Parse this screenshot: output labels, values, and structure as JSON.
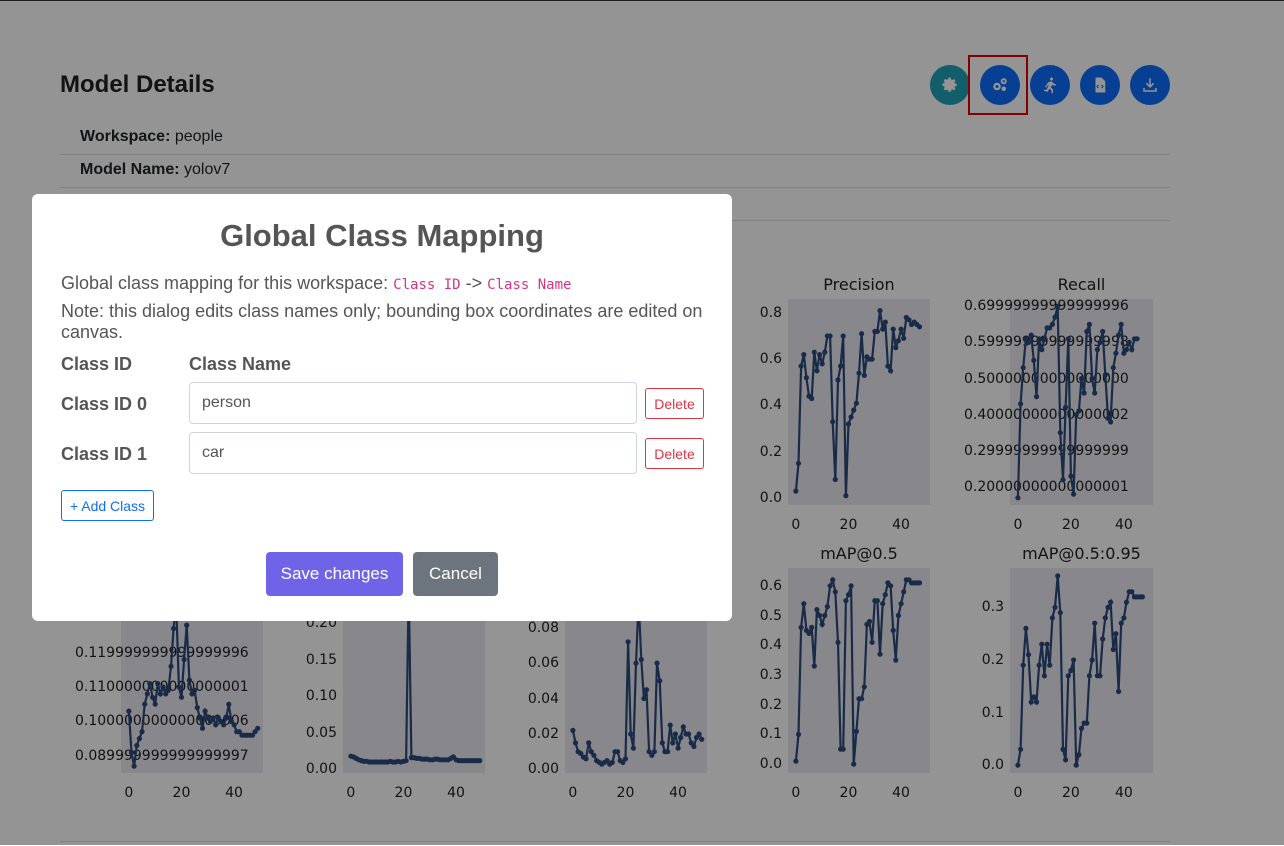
{
  "page": {
    "title": "Model Details",
    "details": [
      {
        "label": "Workspace:",
        "value": "people"
      },
      {
        "label": "Model Name:",
        "value": "yolov7"
      },
      {
        "label": "",
        "value": ""
      }
    ],
    "toolbar": [
      {
        "icon": "gear-icon",
        "color": "#20a4b8"
      },
      {
        "icon": "gears-icon",
        "color": "#0d6efd",
        "highlighted": true
      },
      {
        "icon": "run-icon",
        "color": "#0d6efd"
      },
      {
        "icon": "code-file-icon",
        "color": "#0d6efd"
      },
      {
        "icon": "download-icon",
        "color": "#0d6efd"
      }
    ]
  },
  "modal": {
    "title": "Global Class Mapping",
    "intro_text": "Global class mapping for this workspace:",
    "intro_code_from": "Class ID",
    "intro_arrow": "->",
    "intro_code_to": "Class Name",
    "note": "Note: this dialog edits class names only; bounding box coordinates are edited on canvas.",
    "col_id_header": "Class ID",
    "col_name_header": "Class Name",
    "rows": [
      {
        "id_label": "Class ID 0",
        "name": "person",
        "delete_label": "Delete"
      },
      {
        "id_label": "Class ID 1",
        "name": "car",
        "delete_label": "Delete"
      }
    ],
    "add_label": "+ Add Class",
    "save_label": "Save changes",
    "cancel_label": "Cancel"
  },
  "chart_data": [
    {
      "type": "line",
      "title": "Precision",
      "x_ticks": [
        0,
        20,
        40
      ],
      "y_ticks": [
        0.0,
        0.2,
        0.4,
        0.6,
        0.8
      ],
      "ylim": [
        -0.03,
        0.86
      ],
      "xlim": [
        -3,
        51
      ],
      "series": [
        {
          "values": [
            0.03,
            0.15,
            0.57,
            0.62,
            0.52,
            0.44,
            0.43,
            0.63,
            0.55,
            0.62,
            0.58,
            0.63,
            0.7,
            0.7,
            0.33,
            0.08,
            0.51,
            0.57,
            0.7,
            0.01,
            0.32,
            0.35,
            0.38,
            0.41,
            0.54,
            0.71,
            0.53,
            0.61,
            0.6,
            0.6,
            0.72,
            0.72,
            0.81,
            0.73,
            0.76,
            0.57,
            0.55,
            0.73,
            0.65,
            0.68,
            0.73,
            0.69,
            0.78,
            0.77,
            0.75,
            0.76,
            0.75,
            0.74
          ]
        }
      ]
    },
    {
      "type": "line",
      "title": "Recall",
      "x_ticks": [
        0,
        20,
        40
      ],
      "y_ticks": [
        0.2,
        0.3,
        0.4,
        0.5,
        0.6,
        0.7
      ],
      "ylim": [
        0.15,
        0.72
      ],
      "xlim": [
        -3,
        51
      ],
      "series": [
        {
          "values": [
            0.17,
            0.43,
            0.53,
            0.61,
            0.6,
            0.62,
            0.55,
            0.45,
            0.61,
            0.58,
            0.61,
            0.64,
            0.64,
            0.65,
            0.67,
            0.7,
            0.35,
            0.22,
            0.42,
            0.61,
            0.23,
            0.18,
            0.4,
            0.41,
            0.5,
            0.46,
            0.63,
            0.65,
            0.5,
            0.46,
            0.58,
            0.6,
            0.63,
            0.51,
            0.39,
            0.38,
            0.53,
            0.57,
            0.62,
            0.65,
            0.57,
            0.58,
            0.6,
            0.58,
            0.61,
            0.61
          ]
        }
      ]
    },
    {
      "type": "line",
      "title": "",
      "x_ticks": [
        0,
        20,
        40
      ],
      "y_ticks": [
        0.09,
        0.1,
        0.11,
        0.12
      ],
      "ylim": [
        0.085,
        0.135
      ],
      "xlim": [
        -3,
        51
      ],
      "series": [
        {
          "values": [
            0.103,
            0.091,
            0.087,
            0.093,
            0.095,
            0.097,
            0.105,
            0.108,
            0.111,
            0.107,
            0.105,
            0.111,
            0.108,
            0.11,
            0.108,
            0.109,
            0.116,
            0.127,
            0.134,
            0.11,
            0.107,
            0.118,
            0.128,
            0.112,
            0.108,
            0.109,
            0.104,
            0.101,
            0.098,
            0.103,
            0.101,
            0.1,
            0.101,
            0.099,
            0.101,
            0.1,
            0.099,
            0.101,
            0.105,
            0.1,
            0.099,
            0.097,
            0.097,
            0.096,
            0.096,
            0.096,
            0.096,
            0.096,
            0.097,
            0.098
          ]
        }
      ]
    },
    {
      "type": "line",
      "title": "",
      "x_ticks": [
        0,
        20,
        40
      ],
      "y_ticks": [
        0.0,
        0.05,
        0.1,
        0.15,
        0.2
      ],
      "ylim": [
        -0.005,
        0.23
      ],
      "xlim": [
        -3,
        51
      ],
      "series": [
        {
          "values": [
            0.018,
            0.017,
            0.015,
            0.013,
            0.012,
            0.011,
            0.011,
            0.01,
            0.01,
            0.01,
            0.01,
            0.01,
            0.01,
            0.01,
            0.01,
            0.011,
            0.01,
            0.01,
            0.011,
            0.01,
            0.011,
            0.012,
            0.25,
            0.016,
            0.016,
            0.015,
            0.015,
            0.014,
            0.014,
            0.014,
            0.013,
            0.013,
            0.014,
            0.014,
            0.013,
            0.013,
            0.013,
            0.013,
            0.015,
            0.017,
            0.013,
            0.012,
            0.012,
            0.012,
            0.012,
            0.012,
            0.012,
            0.012,
            0.012,
            0.012
          ]
        }
      ]
    },
    {
      "type": "line",
      "title": "",
      "x_ticks": [
        0,
        20,
        40
      ],
      "y_ticks": [
        0.0,
        0.02,
        0.04,
        0.06,
        0.08
      ],
      "ylim": [
        -0.002,
        0.095
      ],
      "xlim": [
        -3,
        51
      ],
      "series": [
        {
          "values": [
            0.022,
            0.015,
            0.01,
            0.009,
            0.007,
            0.006,
            0.015,
            0.01,
            0.008,
            0.005,
            0.004,
            0.003,
            0.004,
            0.005,
            0.003,
            0.004,
            0.01,
            0.01,
            0.005,
            0.004,
            0.006,
            0.072,
            0.02,
            0.012,
            0.06,
            0.095,
            0.062,
            0.04,
            0.045,
            0.01,
            0.008,
            0.01,
            0.06,
            0.05,
            0.015,
            0.01,
            0.01,
            0.025,
            0.015,
            0.02,
            0.012,
            0.018,
            0.024,
            0.02,
            0.02,
            0.015,
            0.013,
            0.018,
            0.02,
            0.017
          ]
        }
      ]
    },
    {
      "type": "line",
      "title": "mAP@0.5",
      "x_ticks": [
        0,
        20,
        40
      ],
      "y_ticks": [
        0.0,
        0.1,
        0.2,
        0.3,
        0.4,
        0.5,
        0.6
      ],
      "ylim": [
        -0.03,
        0.66
      ],
      "xlim": [
        -3,
        51
      ],
      "series": [
        {
          "values": [
            0.01,
            0.1,
            0.46,
            0.54,
            0.45,
            0.44,
            0.46,
            0.33,
            0.52,
            0.5,
            0.47,
            0.5,
            0.53,
            0.6,
            0.62,
            0.58,
            0.41,
            0.05,
            0.05,
            0.55,
            0.57,
            0.6,
            0.0,
            0.11,
            0.22,
            0.22,
            0.26,
            0.47,
            0.48,
            0.41,
            0.55,
            0.55,
            0.37,
            0.54,
            0.57,
            0.61,
            0.6,
            0.45,
            0.35,
            0.5,
            0.54,
            0.58,
            0.62,
            0.62,
            0.61,
            0.61,
            0.61,
            0.61
          ]
        }
      ]
    },
    {
      "type": "line",
      "title": "mAP@0.5:0.95",
      "x_ticks": [
        0,
        20,
        40
      ],
      "y_ticks": [
        0.0,
        0.1,
        0.2,
        0.3
      ],
      "ylim": [
        -0.015,
        0.375
      ],
      "xlim": [
        -3,
        51
      ],
      "series": [
        {
          "values": [
            0.0,
            0.03,
            0.19,
            0.26,
            0.21,
            0.12,
            0.13,
            0.12,
            0.19,
            0.23,
            0.17,
            0.23,
            0.19,
            0.28,
            0.3,
            0.36,
            0.29,
            0.03,
            0.01,
            0.17,
            0.18,
            0.2,
            0.0,
            0.02,
            0.07,
            0.08,
            0.08,
            0.17,
            0.2,
            0.27,
            0.17,
            0.17,
            0.24,
            0.28,
            0.3,
            0.31,
            0.22,
            0.25,
            0.14,
            0.27,
            0.28,
            0.31,
            0.33,
            0.33,
            0.32,
            0.32,
            0.32,
            0.32
          ]
        }
      ]
    }
  ]
}
